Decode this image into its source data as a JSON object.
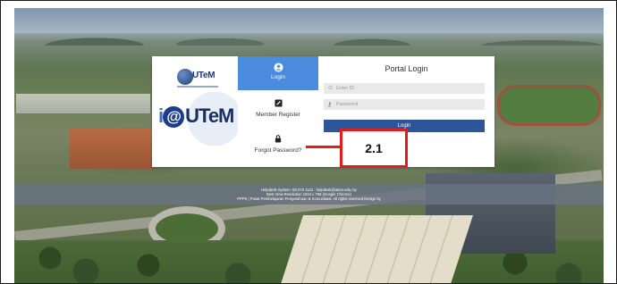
{
  "brand": {
    "small_logo_text": "UTeM",
    "big_logo_text": "UTeM",
    "big_logo_prefix": "i",
    "big_logo_at": "@"
  },
  "nav": {
    "login_label": "Login",
    "register_label": "Member Register",
    "forgot_label": "Forgot Password?"
  },
  "form": {
    "title": "Portal Login",
    "user_placeholder": "Enter ID",
    "pass_placeholder": "Password",
    "login_button": "Login"
  },
  "footer": {
    "line1": "Helpdesk System: 06-270 1141 : helpdesk@utem.edu.my",
    "line2": "Best View Resolution 1024 x 768 (Google Chrome)",
    "line3": "PPPK | Pusat Pembelajaran Pengetahuan & Komunikasi. All rights reserved Design by"
  },
  "annotation": {
    "label": "2.1",
    "color": "#e31c1c"
  },
  "colors": {
    "nav_active": "#4a8bde",
    "login_button": "#2d5599"
  }
}
